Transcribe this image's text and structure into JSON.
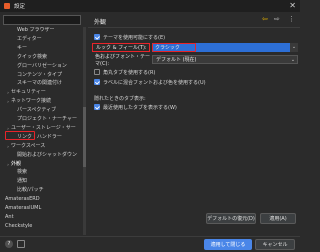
{
  "window": {
    "title": "設定",
    "close_glyph": "✕"
  },
  "filter": {
    "placeholder": ""
  },
  "tree": {
    "items": [
      {
        "label": "Web ブラウザー",
        "indent": 2,
        "twisty": ""
      },
      {
        "label": "エディター",
        "indent": 2,
        "twisty": ""
      },
      {
        "label": "キー",
        "indent": 2,
        "twisty": ""
      },
      {
        "label": "クイック検索",
        "indent": 2,
        "twisty": ""
      },
      {
        "label": "グローバリゼーション",
        "indent": 2,
        "twisty": ""
      },
      {
        "label": "コンテンツ・タイプ",
        "indent": 2,
        "twisty": ""
      },
      {
        "label": "スキーマの関連付け",
        "indent": 2,
        "twisty": ""
      },
      {
        "label": "セキュリティー",
        "indent": 1,
        "twisty": "›"
      },
      {
        "label": "ネットワーク接続",
        "indent": 1,
        "twisty": "›"
      },
      {
        "label": "パースペクティブ",
        "indent": 2,
        "twisty": ""
      },
      {
        "label": "プロジェクト・ナーチャー",
        "indent": 2,
        "twisty": ""
      },
      {
        "label": "ユーザー・ストレージ・サー",
        "indent": 1,
        "twisty": "›"
      },
      {
        "label": "リンク・ハンドラー",
        "indent": 2,
        "twisty": ""
      },
      {
        "label": "ワークスペース",
        "indent": 1,
        "twisty": "›"
      },
      {
        "label": "開始およびシャットダウン",
        "indent": 2,
        "twisty": ""
      },
      {
        "label": "外観",
        "indent": 1,
        "twisty": "›"
      },
      {
        "label": "検索",
        "indent": 2,
        "twisty": ""
      },
      {
        "label": "通知",
        "indent": 2,
        "twisty": ""
      },
      {
        "label": "比較/パッチ",
        "indent": 2,
        "twisty": ""
      },
      {
        "label": "AmaterasERD",
        "indent": 0,
        "twisty": ""
      },
      {
        "label": "AmateraslUML",
        "indent": 0,
        "twisty": ""
      },
      {
        "label": "Ant",
        "indent": 0,
        "twisty": "›"
      },
      {
        "label": "Checkstyle",
        "indent": 0,
        "twisty": ""
      }
    ]
  },
  "panel": {
    "title": "外観",
    "back_glyph": "⇦",
    "forward_glyph": "⇨",
    "menu_glyph": "⋮",
    "theme_enabled_label": "テーマを使用可能にする(E)",
    "look_feel_label": "ルック & フィール(T):",
    "look_feel_value": "クラシック",
    "color_font_label": "色およびフォント・テーマ(C):",
    "color_font_value": "デフォルト (現在)",
    "round_tabs_label": "角丸タブを使用する(R)",
    "mixed_fonts_label": "ラベルに混合フォントおよび色を使用する(U)",
    "tab_shortcut_title": "隠れたときのタブ表示:",
    "recent_tabs_label": "最近使用したタブを表示する(W)",
    "restore_defaults": "デフォルトの復元(D)",
    "apply": "適用(A)",
    "combo_arrow": "⌄"
  },
  "footer": {
    "help_glyph": "?",
    "apply_close": "適用して閉じる",
    "cancel": "キャンセル"
  },
  "colors": {
    "accent": "#4a86e8",
    "highlight_red": "#e8242a",
    "background": "#2b2b2b"
  }
}
